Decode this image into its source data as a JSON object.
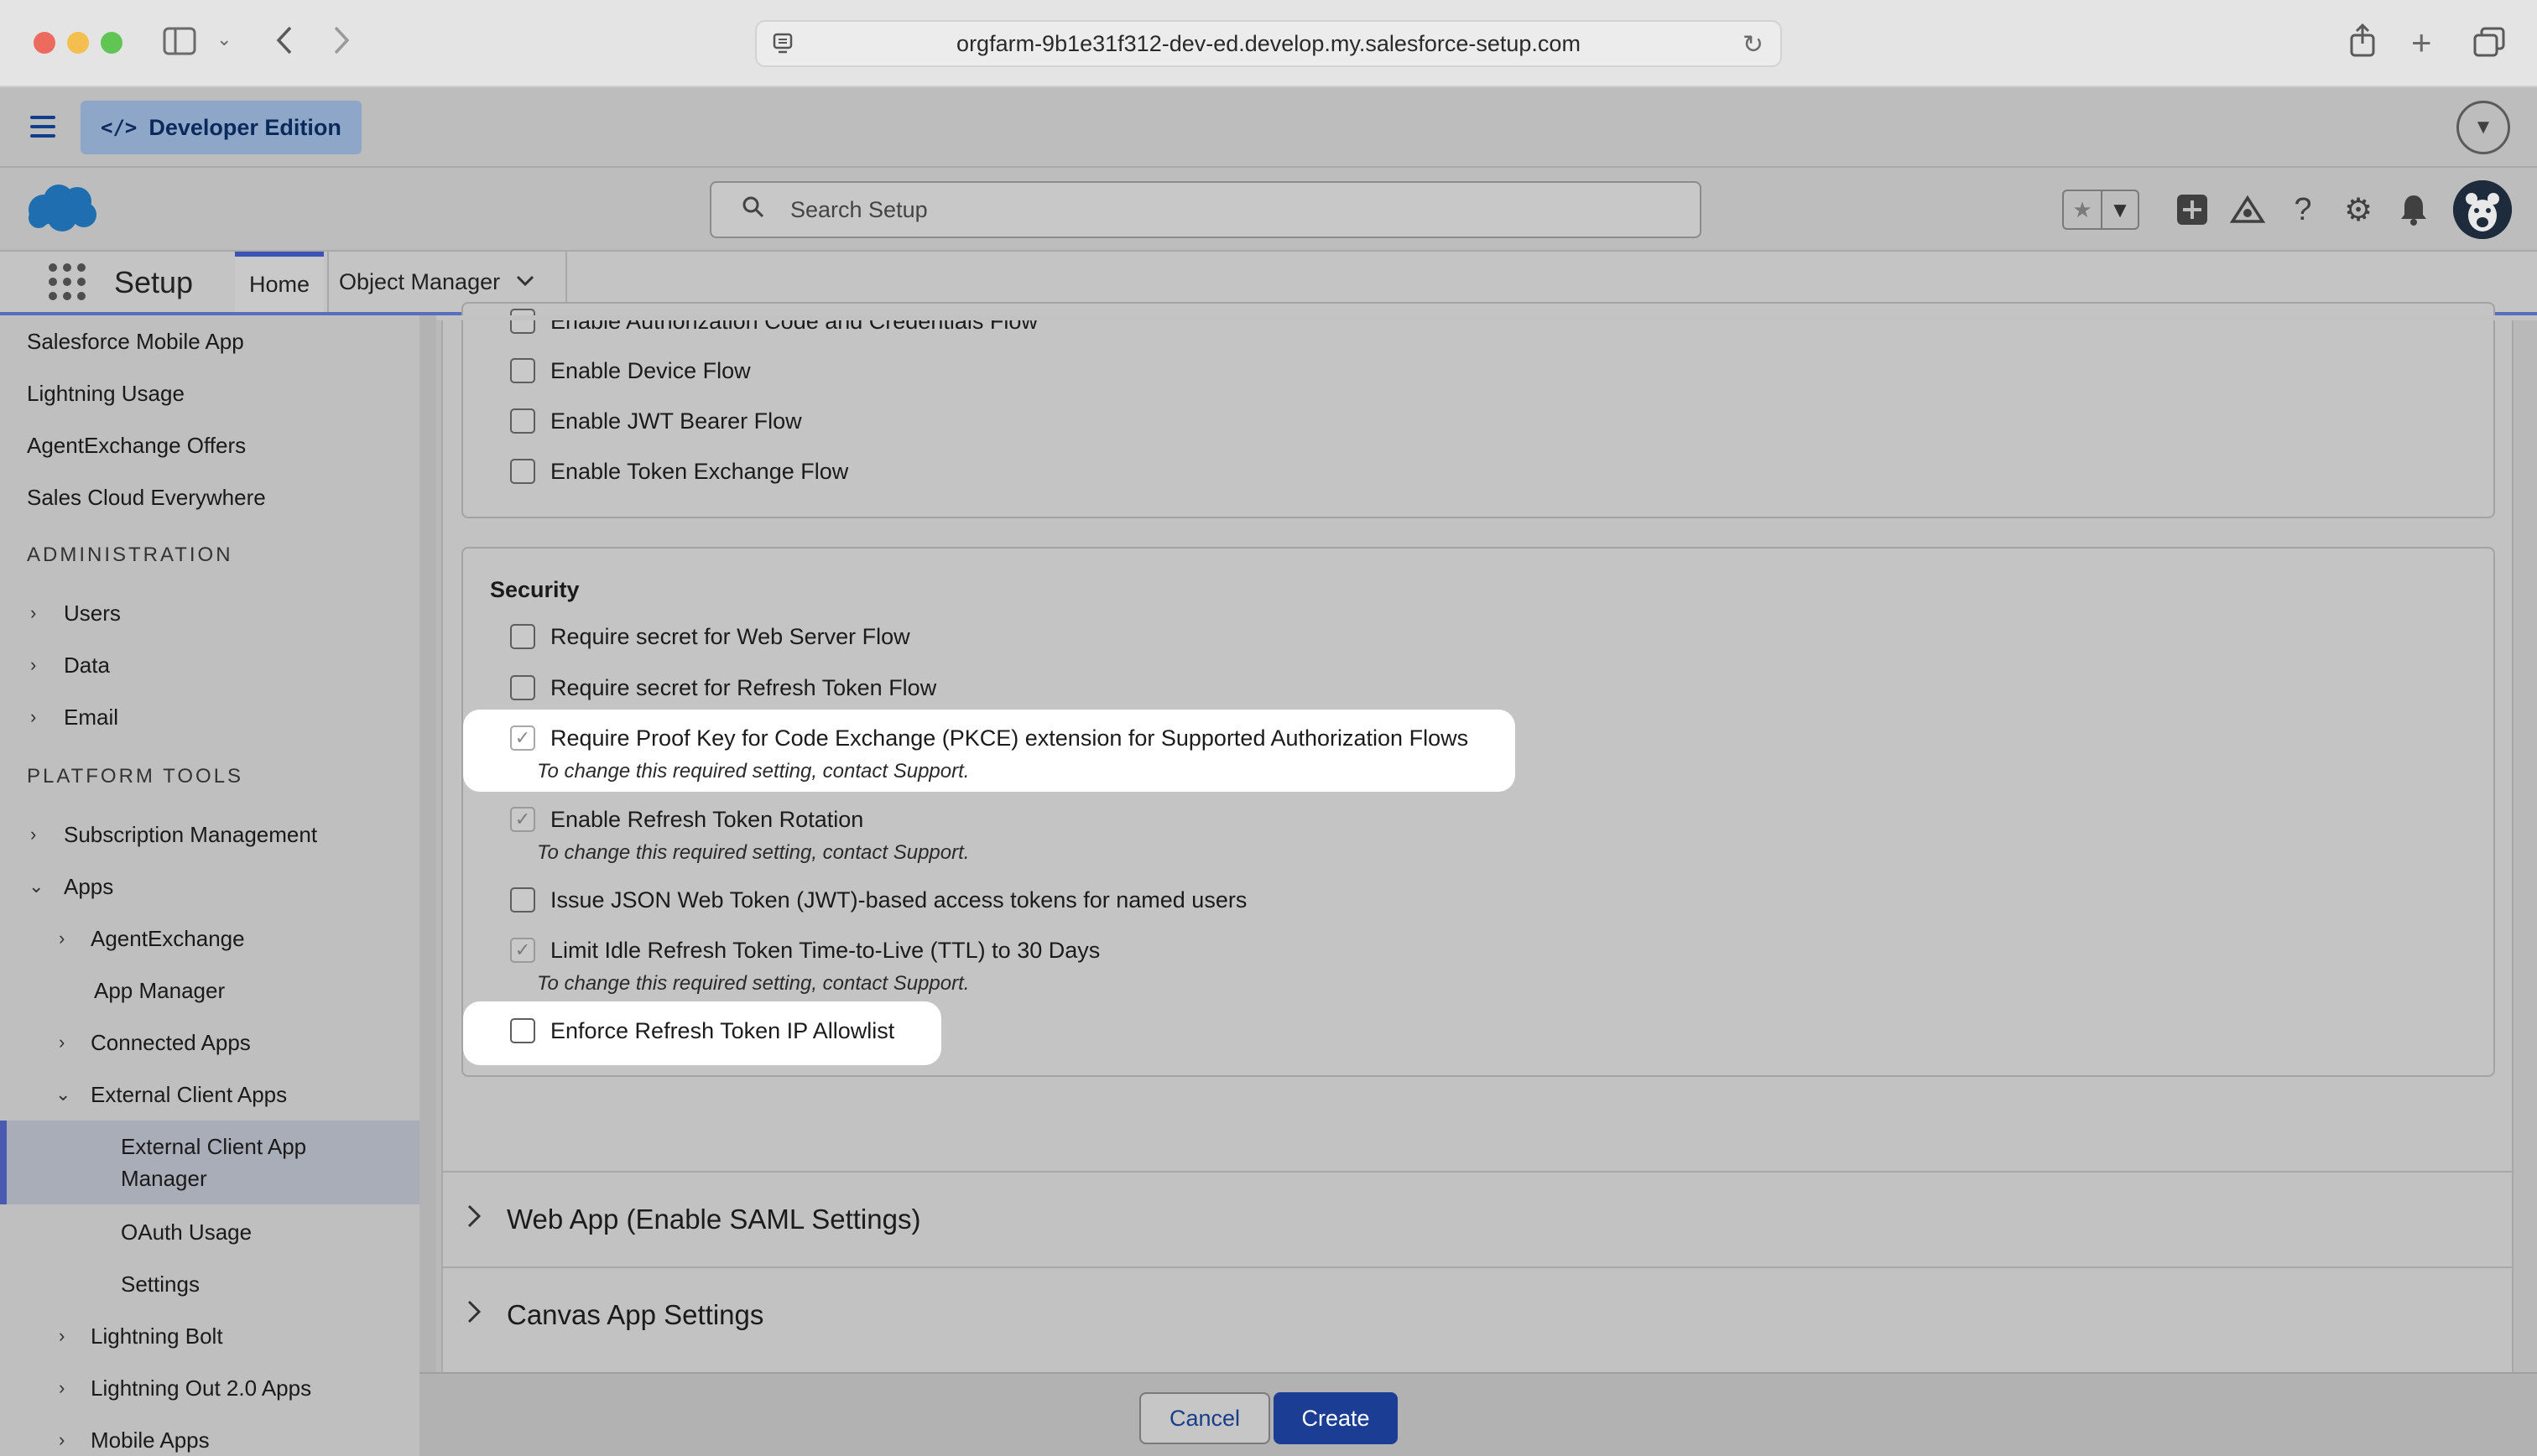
{
  "browser": {
    "url": "orgfarm-9b1e31f312-dev-ed.develop.my.salesforce-setup.com"
  },
  "header": {
    "edition_badge": "Developer Edition",
    "search_placeholder": "Search Setup"
  },
  "setup_nav": {
    "title": "Setup",
    "tabs": [
      {
        "label": "Home"
      },
      {
        "label": "Object Manager"
      }
    ]
  },
  "sidebar": {
    "items": [
      {
        "label": "Salesforce Mobile App"
      },
      {
        "label": "Lightning Usage"
      },
      {
        "label": "AgentExchange Offers"
      },
      {
        "label": "Sales Cloud Everywhere"
      }
    ],
    "headings": {
      "administration": "ADMINISTRATION",
      "platform_tools": "PLATFORM TOOLS"
    },
    "admin_items": [
      {
        "label": "Users"
      },
      {
        "label": "Data"
      },
      {
        "label": "Email"
      }
    ],
    "platform_items": [
      {
        "label": "Subscription Management"
      },
      {
        "label": "Apps"
      },
      {
        "label": "AgentExchange"
      },
      {
        "label": "App Manager"
      },
      {
        "label": "Connected Apps"
      },
      {
        "label": "External Client Apps"
      },
      {
        "label": "External Client App Manager"
      },
      {
        "label": "OAuth Usage"
      },
      {
        "label": "Settings"
      },
      {
        "label": "Lightning Bolt"
      },
      {
        "label": "Lightning Out 2.0 Apps"
      },
      {
        "label": "Mobile Apps"
      }
    ]
  },
  "flows": {
    "items": [
      {
        "label": "Enable Authorization Code and Credentials Flow",
        "checked": false
      },
      {
        "label": "Enable Device Flow",
        "checked": false
      },
      {
        "label": "Enable JWT Bearer Flow",
        "checked": false
      },
      {
        "label": "Enable Token Exchange Flow",
        "checked": false
      }
    ]
  },
  "security": {
    "title": "Security",
    "items": [
      {
        "label": "Require secret for Web Server Flow",
        "checked": false
      },
      {
        "label": "Require secret for Refresh Token Flow",
        "checked": false
      },
      {
        "label": "Require Proof Key for Code Exchange (PKCE) extension for Supported Authorization Flows",
        "checked": true,
        "note": "To change this required setting, contact Support."
      },
      {
        "label": "Enable Refresh Token Rotation",
        "checked": true,
        "note": "To change this required setting, contact Support."
      },
      {
        "label": "Issue JSON Web Token (JWT)-based access tokens for named users",
        "checked": false
      },
      {
        "label": "Limit Idle Refresh Token Time-to-Live (TTL) to 30 Days",
        "checked": true,
        "note": "To change this required setting, contact Support."
      },
      {
        "label": "Enforce Refresh Token IP Allowlist",
        "checked": false
      }
    ]
  },
  "sections": [
    {
      "label": "Web App (Enable SAML Settings)"
    },
    {
      "label": "Canvas App Settings"
    }
  ],
  "footer": {
    "cancel_label": "Cancel",
    "create_label": "Create"
  },
  "check_mark": "✓",
  "colors": {
    "brand_blue": "#1b3d94",
    "salesforce_cloud": "#1c8fd6"
  }
}
